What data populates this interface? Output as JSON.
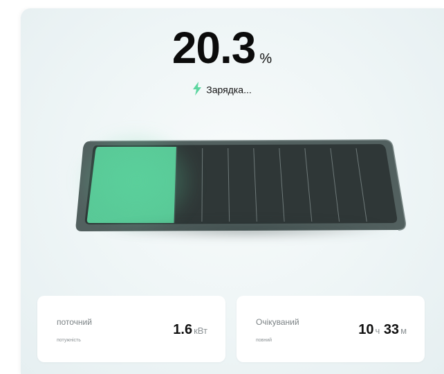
{
  "battery": {
    "level_value": "20.3",
    "level_unit": "%",
    "level_fraction": 0.203,
    "status_text": "Зарядка...",
    "status_icon": "bolt-icon",
    "accent_color": "#5dd6a0",
    "segments": 8
  },
  "stats": {
    "current": {
      "label": "поточний",
      "sublabel": "потужність",
      "value": "1.6",
      "unit": "кВт"
    },
    "expected": {
      "label": "Очікуваний",
      "sublabel": "повний",
      "hours": "10",
      "hours_unit": "ч",
      "minutes": "33",
      "minutes_unit": "м"
    }
  }
}
